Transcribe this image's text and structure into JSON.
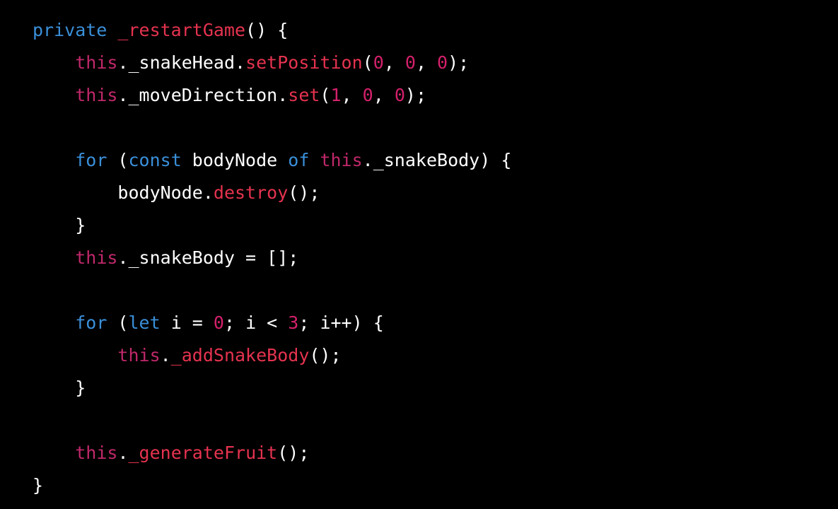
{
  "colors": {
    "background": "#000000",
    "plain": "#ffffff",
    "keyword": "#3a8fd9",
    "this": "#c0286a",
    "method": "#e5334f",
    "number": "#d4206b"
  },
  "code": {
    "lines": [
      {
        "indent": 0,
        "tokens": [
          {
            "t": "private ",
            "k": "keyword"
          },
          {
            "t": "_restartGame",
            "k": "method"
          },
          {
            "t": "() {",
            "k": "plain"
          }
        ]
      },
      {
        "indent": 1,
        "tokens": [
          {
            "t": "this",
            "k": "this"
          },
          {
            "t": "._snakeHead.",
            "k": "plain"
          },
          {
            "t": "setPosition",
            "k": "method"
          },
          {
            "t": "(",
            "k": "plain"
          },
          {
            "t": "0",
            "k": "number"
          },
          {
            "t": ", ",
            "k": "plain"
          },
          {
            "t": "0",
            "k": "number"
          },
          {
            "t": ", ",
            "k": "plain"
          },
          {
            "t": "0",
            "k": "number"
          },
          {
            "t": ");",
            "k": "plain"
          }
        ]
      },
      {
        "indent": 1,
        "tokens": [
          {
            "t": "this",
            "k": "this"
          },
          {
            "t": "._moveDirection.",
            "k": "plain"
          },
          {
            "t": "set",
            "k": "method"
          },
          {
            "t": "(",
            "k": "plain"
          },
          {
            "t": "1",
            "k": "number"
          },
          {
            "t": ", ",
            "k": "plain"
          },
          {
            "t": "0",
            "k": "number"
          },
          {
            "t": ", ",
            "k": "plain"
          },
          {
            "t": "0",
            "k": "number"
          },
          {
            "t": ");",
            "k": "plain"
          }
        ]
      },
      {
        "indent": 0,
        "tokens": []
      },
      {
        "indent": 1,
        "tokens": [
          {
            "t": "for",
            "k": "keyword"
          },
          {
            "t": " (",
            "k": "plain"
          },
          {
            "t": "const",
            "k": "keyword"
          },
          {
            "t": " bodyNode ",
            "k": "plain"
          },
          {
            "t": "of",
            "k": "keyword"
          },
          {
            "t": " ",
            "k": "plain"
          },
          {
            "t": "this",
            "k": "this"
          },
          {
            "t": "._snakeBody) {",
            "k": "plain"
          }
        ]
      },
      {
        "indent": 2,
        "tokens": [
          {
            "t": "bodyNode.",
            "k": "plain"
          },
          {
            "t": "destroy",
            "k": "method"
          },
          {
            "t": "();",
            "k": "plain"
          }
        ]
      },
      {
        "indent": 1,
        "tokens": [
          {
            "t": "}",
            "k": "plain"
          }
        ]
      },
      {
        "indent": 1,
        "tokens": [
          {
            "t": "this",
            "k": "this"
          },
          {
            "t": "._snakeBody = [];",
            "k": "plain"
          }
        ]
      },
      {
        "indent": 0,
        "tokens": []
      },
      {
        "indent": 1,
        "tokens": [
          {
            "t": "for",
            "k": "keyword"
          },
          {
            "t": " (",
            "k": "plain"
          },
          {
            "t": "let",
            "k": "keyword"
          },
          {
            "t": " i = ",
            "k": "plain"
          },
          {
            "t": "0",
            "k": "number"
          },
          {
            "t": "; i < ",
            "k": "plain"
          },
          {
            "t": "3",
            "k": "number"
          },
          {
            "t": "; i++) {",
            "k": "plain"
          }
        ]
      },
      {
        "indent": 2,
        "tokens": [
          {
            "t": "this",
            "k": "this"
          },
          {
            "t": ".",
            "k": "plain"
          },
          {
            "t": "_addSnakeBody",
            "k": "method"
          },
          {
            "t": "();",
            "k": "plain"
          }
        ]
      },
      {
        "indent": 1,
        "tokens": [
          {
            "t": "}",
            "k": "plain"
          }
        ]
      },
      {
        "indent": 0,
        "tokens": []
      },
      {
        "indent": 1,
        "tokens": [
          {
            "t": "this",
            "k": "this"
          },
          {
            "t": ".",
            "k": "plain"
          },
          {
            "t": "_generateFruit",
            "k": "method"
          },
          {
            "t": "();",
            "k": "plain"
          }
        ]
      },
      {
        "indent": 0,
        "tokens": [
          {
            "t": "}",
            "k": "plain"
          }
        ]
      }
    ]
  }
}
